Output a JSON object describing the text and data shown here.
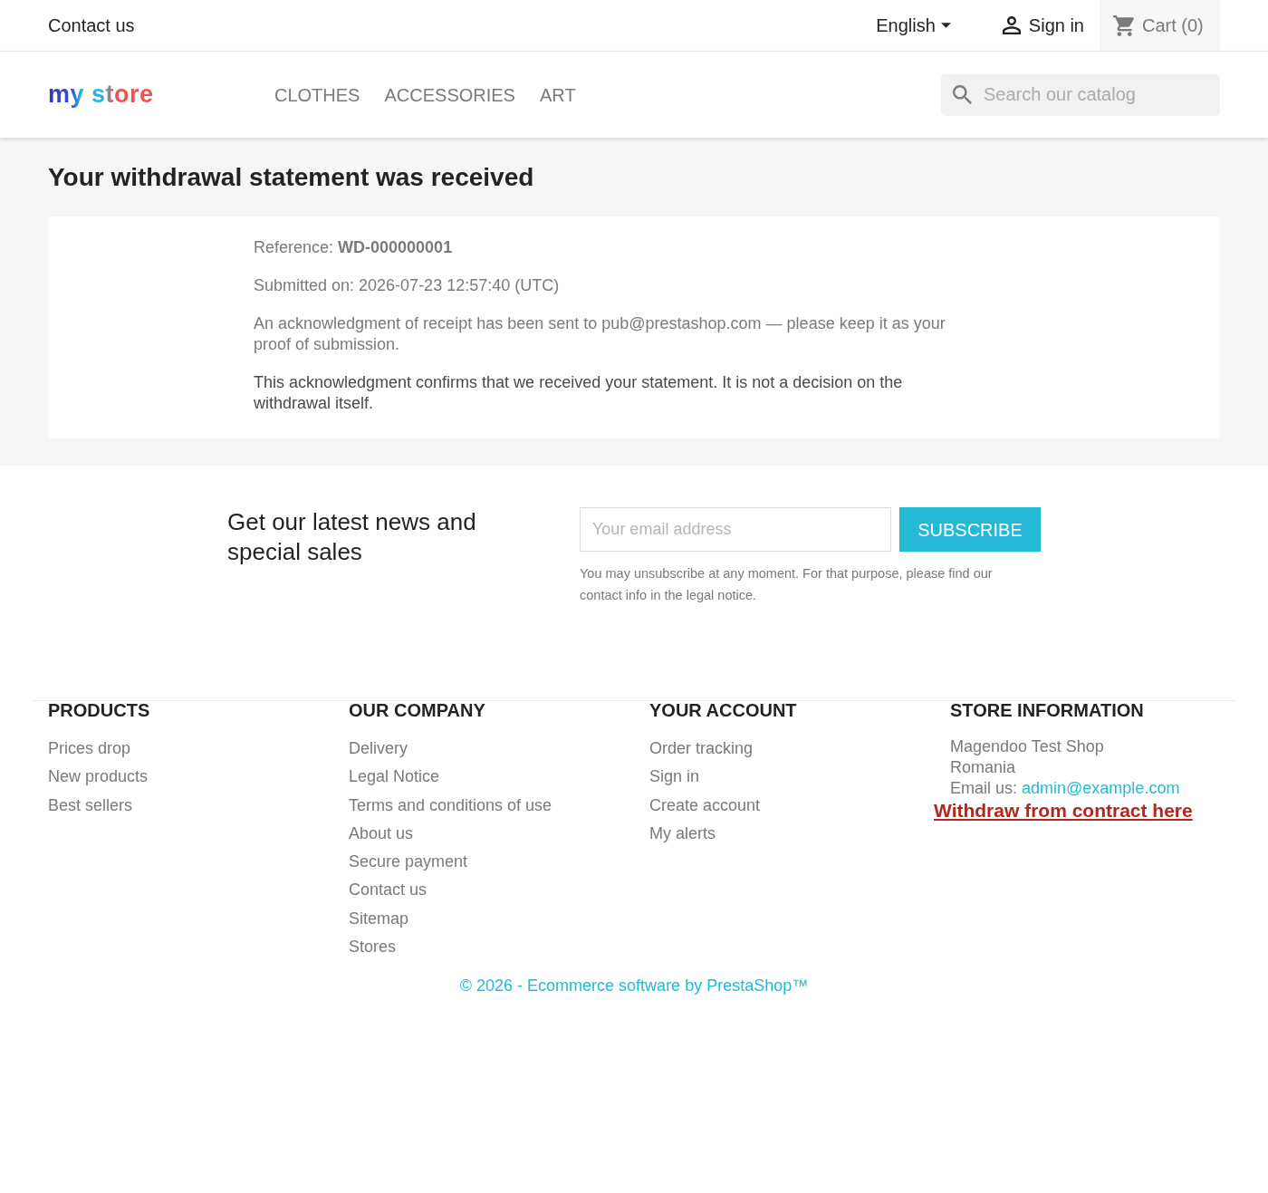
{
  "top_bar": {
    "contact": "Contact us",
    "language": "English",
    "sign_in": "Sign in",
    "cart": "Cart (0)"
  },
  "header": {
    "logo": "my store",
    "nav": [
      "CLOTHES",
      "ACCESSORIES",
      "ART"
    ],
    "search": {
      "placeholder": "Search our catalog"
    }
  },
  "main": {
    "title": "Your withdrawal statement was received",
    "paragraphs": [
      {
        "kind": "detail",
        "text": "Reference: **WD-000000001**"
      },
      {
        "kind": "detail",
        "text": "Submitted on: 2026-07-23 12:57:40 (UTC)"
      },
      {
        "kind": "detail",
        "text": "An acknowledgment of receipt has been sent to pub@prestashop.com — please keep it as your proof of submission."
      },
      {
        "kind": "notice",
        "text": "This acknowledgment confirms that we received your statement. It is not a decision on the withdrawal itself."
      }
    ]
  },
  "newsletter": {
    "heading": "Get our latest news and special sales",
    "email": {
      "placeholder": "Your email address"
    },
    "button": "SUBSCRIBE",
    "note": "You may unsubscribe at any moment. For that purpose, please find our contact info in the legal notice."
  },
  "footer": {
    "columns": [
      {
        "kind": "links",
        "heading": "PRODUCTS",
        "links": [
          "Prices drop",
          "New products",
          "Best sellers"
        ]
      },
      {
        "kind": "links",
        "heading": "OUR COMPANY",
        "links": [
          "Delivery",
          "Legal Notice",
          "Terms and conditions of use",
          "About us",
          "Secure payment",
          "Contact us",
          "Sitemap",
          "Stores"
        ]
      },
      {
        "kind": "links",
        "heading": "YOUR ACCOUNT",
        "links": [
          "Order tracking",
          "Sign in",
          "Create account",
          "My alerts"
        ]
      },
      {
        "kind": "store_info",
        "heading": "STORE INFORMATION",
        "lines": [
          "Magendoo Test Shop",
          "Romania"
        ],
        "email_label": "Email us:",
        "email": "admin@example.com",
        "withdraw_link": "Withdraw from contract here"
      }
    ],
    "copyright": "© 2026 - Ecommerce software by PrestaShop™"
  }
}
